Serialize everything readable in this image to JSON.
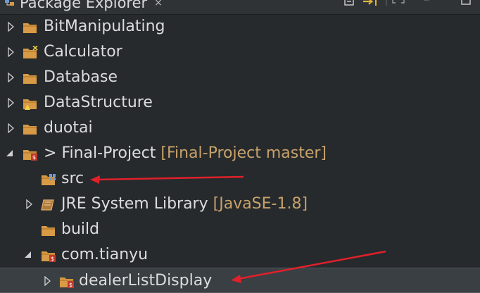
{
  "view": {
    "title": "Package Explorer",
    "close": "×"
  },
  "tree": {
    "items": [
      {
        "label": "BitManipulating",
        "decoration": ""
      },
      {
        "label": "Calculator",
        "decoration": ""
      },
      {
        "label": "Database",
        "decoration": ""
      },
      {
        "label": "DataStructure",
        "decoration": ""
      },
      {
        "label": "duotai",
        "decoration": ""
      },
      {
        "prefix": "> ",
        "label": "Final-Project",
        "decoration": "[Final-Project master]"
      },
      {
        "label": "src",
        "decoration": ""
      },
      {
        "label": "JRE System Library",
        "decoration": "[JavaSE-1.8]"
      },
      {
        "label": "build",
        "decoration": ""
      },
      {
        "label": "com.tianyu",
        "decoration": ""
      },
      {
        "label": "dealerListDisplay",
        "decoration": ""
      }
    ]
  },
  "colors": {
    "background": "#262a2d",
    "folder": "#d89a45",
    "decoration": "#c8a26a",
    "annotation_arrow": "#e0202a",
    "selection": "#3a3f44"
  }
}
